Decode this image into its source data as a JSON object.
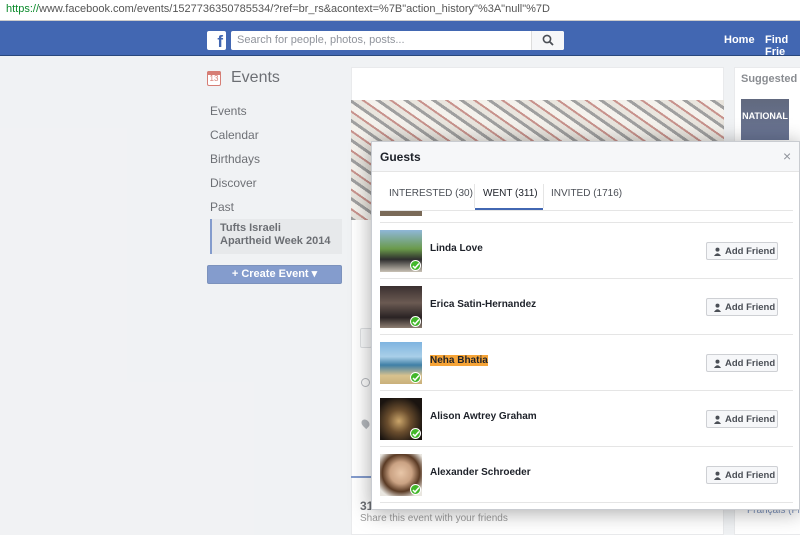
{
  "browser": {
    "url_scheme": "https://",
    "url_rest": "www.facebook.com/events/1527736350785534/?ref=br_rs&acontext=%7B\"action_history\"%3A\"null\"%7D"
  },
  "topbar": {
    "logo": "f",
    "search_placeholder": "Search for people, photos, posts...",
    "nav": [
      "Home",
      "Find Frie"
    ]
  },
  "sidebar": {
    "title": "Events",
    "calendar_day": "13",
    "items": [
      "Events",
      "Calendar",
      "Birthdays",
      "Discover",
      "Past"
    ],
    "selected": "Tufts Israeli Apartheid Week 2014",
    "create_button": "+ Create Event ▾"
  },
  "main": {
    "share_count": "31",
    "share_text": "Share this event with your friends"
  },
  "right": {
    "title": "Suggested Ev",
    "thumb_text": "NATIONAL",
    "lang": "Français (Fra"
  },
  "modal": {
    "title": "Guests",
    "close": "×",
    "tabs": [
      "INTERESTED (30)",
      "WENT (311)",
      "INVITED (1716)"
    ],
    "active_tab": "WENT (311)",
    "add_friend_label": "Add Friend",
    "guests": [
      {
        "name": "Linda Love",
        "highlighted": false
      },
      {
        "name": "Erica Satin-Hernandez",
        "highlighted": false
      },
      {
        "name": "Neha Bhatia",
        "highlighted": true
      },
      {
        "name": "Alison Awtrey Graham",
        "highlighted": false
      },
      {
        "name": "Alexander Schroeder",
        "highlighted": false
      }
    ]
  },
  "colors": {
    "facebook_blue": "#4267b2",
    "went_check": "#42b72a",
    "highlight": "#f6a437"
  }
}
